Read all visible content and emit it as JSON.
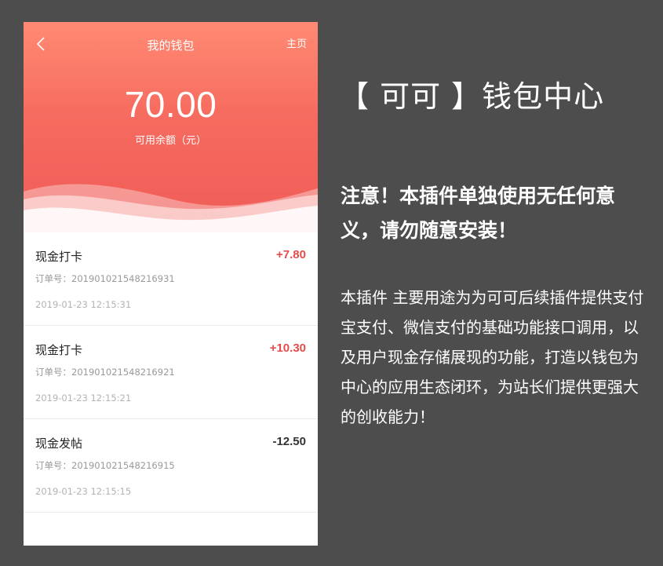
{
  "header": {
    "title": "我的钱包",
    "home_label": "主页",
    "balance": "70.00",
    "balance_label": "可用余额（元）"
  },
  "records": [
    {
      "name": "现金打卡",
      "amount": "+7.80",
      "type": "pos",
      "order": "订单号：201901021548216931",
      "time": "2019-01-23 12:15:31"
    },
    {
      "name": "现金打卡",
      "amount": "+10.30",
      "type": "pos",
      "order": "订单号：201901021548216921",
      "time": "2019-01-23 12:15:21"
    },
    {
      "name": "现金发帖",
      "amount": "-12.50",
      "type": "neg",
      "order": "订单号：201901021548216915",
      "time": "2019-01-23 12:15:15"
    }
  ],
  "promo": {
    "title": "【 可可 】钱包中心",
    "warning": "注意！本插件单独使用无任何意义，请勿随意安装！",
    "description": "本插件 主要用途为为可可后续插件提供支付宝支付、微信支付的基础功能接口调用，以及用户现金存储展现的功能，打造以钱包为中心的应用生态闭环，为站长们提供更强大的创收能力！"
  },
  "colors": {
    "header_top": "#ff8a73",
    "header_bottom": "#ef5b57",
    "positive": "#e54b4b",
    "negative": "#333333",
    "background": "#4d4d4d"
  }
}
